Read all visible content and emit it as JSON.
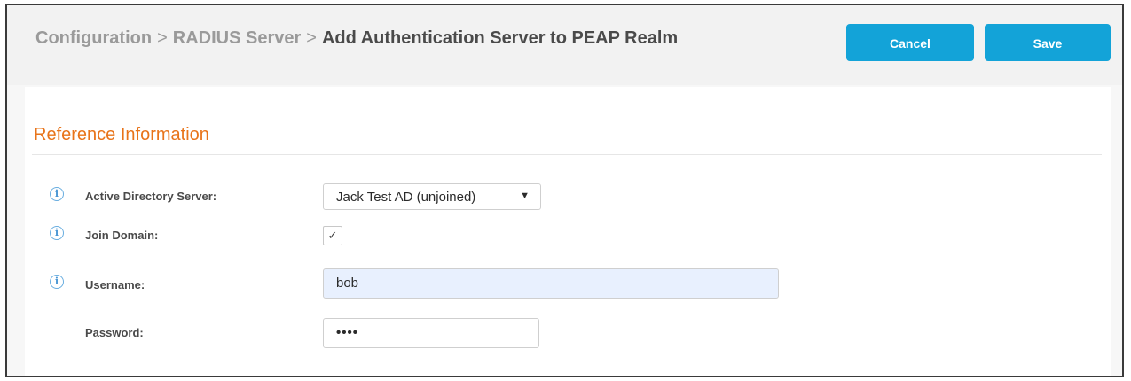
{
  "breadcrumb": {
    "items": [
      "Configuration",
      "RADIUS Server"
    ],
    "separator": ">",
    "current": "Add Authentication Server to PEAP Realm"
  },
  "toolbar": {
    "cancel_label": "Cancel",
    "save_label": "Save"
  },
  "section": {
    "title": "Reference Information"
  },
  "form": {
    "ad_server": {
      "label": "Active Directory Server:",
      "value": "Jack Test AD (unjoined)",
      "arrow": "▼",
      "has_info": true
    },
    "join_domain": {
      "label": "Join Domain:",
      "checked": true,
      "check_mark": "✓",
      "has_info": true
    },
    "username": {
      "label": "Username:",
      "value": "bob",
      "has_info": true
    },
    "password": {
      "label": "Password:",
      "value": "••••",
      "has_info": false
    }
  },
  "icons": {
    "info_glyph": "i"
  },
  "colors": {
    "accent": "#13a3d8",
    "section_title": "#e8741a",
    "info_icon": "#4a96d4",
    "autofill_bg": "#e8f0fe"
  }
}
